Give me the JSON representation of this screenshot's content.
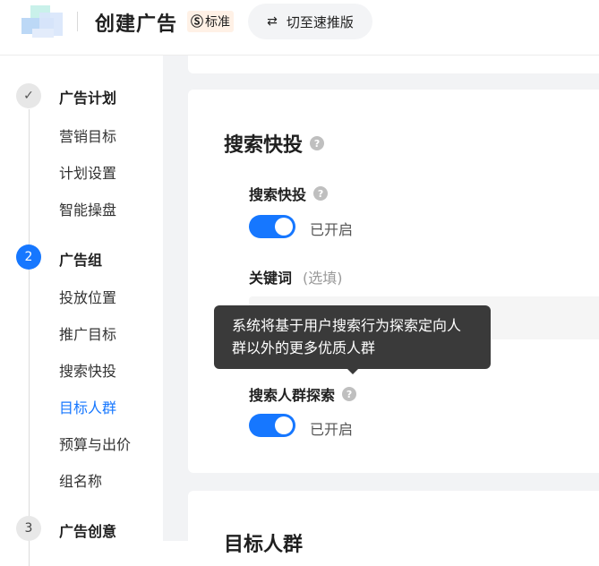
{
  "header": {
    "title": "创建广告",
    "badge_icon": "Ⓢ",
    "badge_label": "标准",
    "switch_label": "切至速推版"
  },
  "sidebar": {
    "steps": [
      {
        "number": "✓",
        "title": "广告计划",
        "state": "done",
        "items": [
          "营销目标",
          "计划设置",
          "智能操盘"
        ]
      },
      {
        "number": "2",
        "title": "广告组",
        "state": "active",
        "items": [
          "投放位置",
          "推广目标",
          "搜索快投",
          "目标人群",
          "预算与出价",
          "组名称"
        ]
      },
      {
        "number": "3",
        "title": "广告创意",
        "state": "todo",
        "items": []
      }
    ],
    "current_item": "目标人群"
  },
  "main": {
    "section_title": "搜索快投",
    "quick_search": {
      "label": "搜索快投",
      "toggle_on": true,
      "status": "已开启"
    },
    "keywords": {
      "label": "关键词",
      "optional": "(选填)"
    },
    "tooltip": {
      "line1": "系统将基于用户搜索行为探索定向人",
      "line2": "群以外的更多优质人群"
    },
    "audience_explore": {
      "label": "搜索人群探索",
      "toggle_on": true,
      "status": "已开启"
    },
    "next_section_title": "目标人群"
  },
  "colors": {
    "accent": "#1677ff",
    "tooltip_bg": "#3a3a3a",
    "page_bg": "#f2f3f5"
  }
}
